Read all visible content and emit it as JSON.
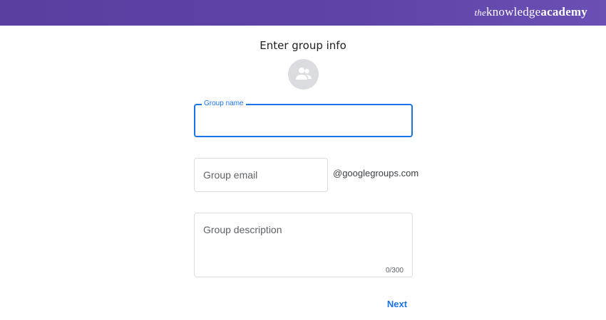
{
  "banner": {
    "brand_the": "the",
    "brand_knowledge": "knowledge",
    "brand_academy": "academy"
  },
  "page": {
    "title": "Enter group info"
  },
  "form": {
    "group_name": {
      "label": "Group name",
      "value": ""
    },
    "group_email": {
      "placeholder": "Group email",
      "value": "",
      "suffix": "@googlegroups.com"
    },
    "group_description": {
      "placeholder": "Group description",
      "value": "",
      "counter": "0/300"
    },
    "next_label": "Next"
  },
  "colors": {
    "accent": "#1a73e8",
    "banner": "#5a3ea0",
    "avatar_bg": "#dadce0"
  },
  "icons": {
    "avatar": "group-icon"
  }
}
